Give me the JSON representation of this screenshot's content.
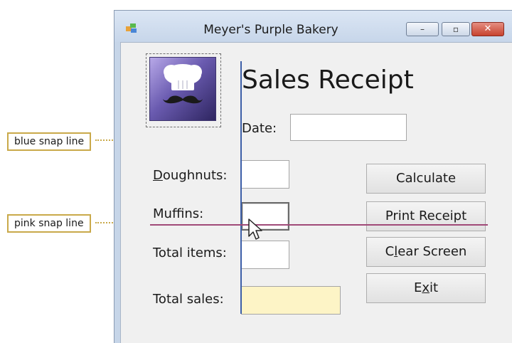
{
  "window": {
    "title": "Meyer's Purple Bakery"
  },
  "controls": {
    "minimize": "–",
    "maximize": "▫",
    "close": "✕"
  },
  "form": {
    "heading": "Sales Receipt",
    "date_label": "Date:",
    "date_value": "",
    "doughnuts_label": {
      "mnemonic": "D",
      "rest": "oughnuts:"
    },
    "muffins_label": "Muffins:",
    "total_items_label": "Total items:",
    "total_sales_label": "Total sales:"
  },
  "buttons": {
    "calculate": "Calculate",
    "print": "Print Receipt",
    "clear": {
      "pre": "C",
      "mnemonic": "l",
      "post": "ear Screen"
    },
    "exit": {
      "pre": "E",
      "mnemonic": "x",
      "post": "it"
    }
  },
  "callouts": {
    "blue": "blue snap line",
    "pink": "pink snap line"
  },
  "colors": {
    "accent_purple": "#6a5bb0",
    "snap_blue": "#3d5fa8",
    "snap_pink": "#a04a78",
    "callout_border": "#c9a94a",
    "total_sales_fill": "#fdf4c6"
  },
  "icons": [
    "app-icon",
    "chef-hat-mustache-icon",
    "mouse-pointer-icon"
  ]
}
